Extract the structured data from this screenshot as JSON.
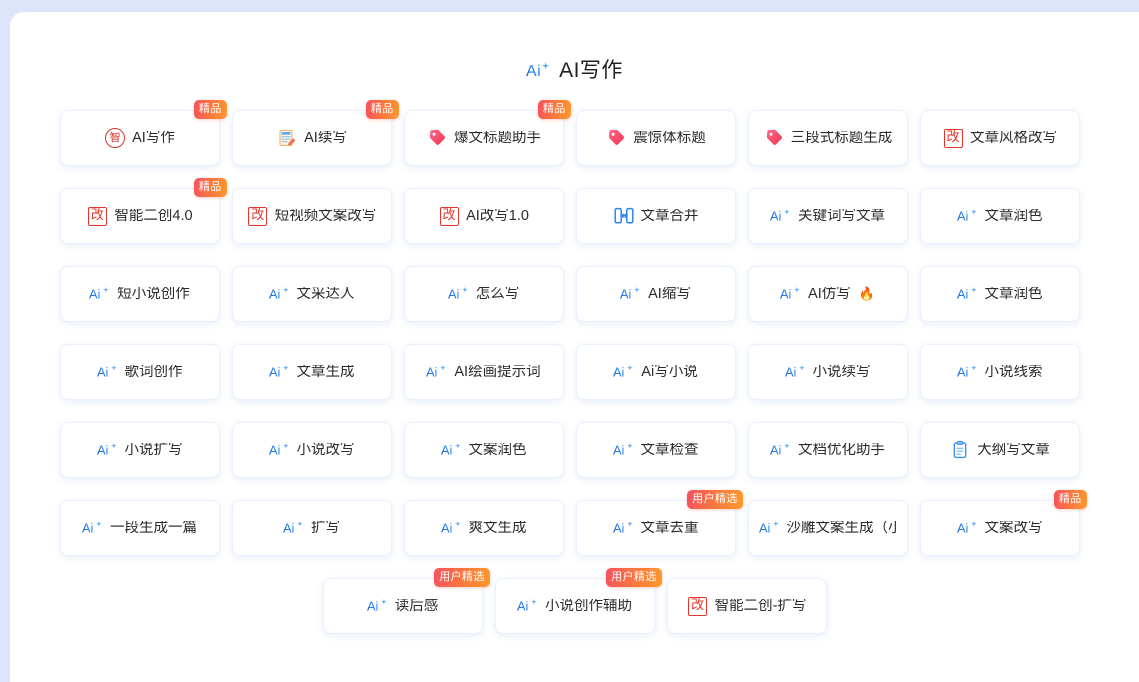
{
  "header": {
    "title": "AI写作",
    "icon": "ai-sparkle-icon"
  },
  "badges": {
    "premium": "精品",
    "user_pick": "用户精选"
  },
  "colors": {
    "page_background": "#dde5fb",
    "panel_background": "#ffffff",
    "card_border": "#e8f0fe",
    "ai_icon_blue": "#1677ff",
    "badge_gradient_start": "#f5515f",
    "badge_gradient_end": "#ff9a2e",
    "gai_icon_red": "#e8352c",
    "tag_icon_pink": "#f5486a",
    "text": "#2b2b2b"
  },
  "rows": [
    {
      "cards": [
        {
          "label": "AI写作",
          "icon": "seal-zhi-icon",
          "badge": "精品"
        },
        {
          "label": "AI续写",
          "icon": "document-pen-icon",
          "badge": "精品"
        },
        {
          "label": "爆文标题助手",
          "icon": "tag-icon",
          "badge": "精品"
        },
        {
          "label": "震惊体标题",
          "icon": "tag-icon",
          "badge": null
        },
        {
          "label": "三段式标题生成",
          "icon": "tag-icon",
          "badge": null
        },
        {
          "label": "文章风格改写",
          "icon": "gai-box-icon",
          "badge": null
        }
      ]
    },
    {
      "cards": [
        {
          "label": "智能二创4.0",
          "icon": "gai-box-icon",
          "badge": "精品"
        },
        {
          "label": "短视频文案改写",
          "icon": "gai-box-icon",
          "badge": null
        },
        {
          "label": "AI改写1.0",
          "icon": "gai-box-icon",
          "badge": null
        },
        {
          "label": "文章合并",
          "icon": "merge-icon",
          "badge": null
        },
        {
          "label": "关键词写文章",
          "icon": "ai-sparkle-icon",
          "badge": null
        },
        {
          "label": "文章润色",
          "icon": "ai-sparkle-icon",
          "badge": null
        }
      ]
    },
    {
      "cards": [
        {
          "label": "短小说创作",
          "icon": "ai-sparkle-icon",
          "badge": null
        },
        {
          "label": "文采达人",
          "icon": "ai-sparkle-icon",
          "badge": null
        },
        {
          "label": "怎么写",
          "icon": "ai-sparkle-icon",
          "badge": null
        },
        {
          "label": "AI缩写",
          "icon": "ai-sparkle-icon",
          "badge": null
        },
        {
          "label": "AI仿写",
          "icon": "ai-sparkle-icon",
          "badge": null,
          "suffix": "🔥"
        },
        {
          "label": "文章润色",
          "icon": "ai-sparkle-icon",
          "badge": null
        }
      ]
    },
    {
      "cards": [
        {
          "label": "歌词创作",
          "icon": "ai-sparkle-icon",
          "badge": null
        },
        {
          "label": "文章生成",
          "icon": "ai-sparkle-icon",
          "badge": null
        },
        {
          "label": "AI绘画提示词",
          "icon": "ai-sparkle-icon",
          "badge": null
        },
        {
          "label": "Ai写小说",
          "icon": "ai-sparkle-icon",
          "badge": null
        },
        {
          "label": "小说续写",
          "icon": "ai-sparkle-icon",
          "badge": null
        },
        {
          "label": "小说线索",
          "icon": "ai-sparkle-icon",
          "badge": null
        }
      ]
    },
    {
      "cards": [
        {
          "label": "小说扩写",
          "icon": "ai-sparkle-icon",
          "badge": null
        },
        {
          "label": "小说改写",
          "icon": "ai-sparkle-icon",
          "badge": null
        },
        {
          "label": "文案润色",
          "icon": "ai-sparkle-icon",
          "badge": null
        },
        {
          "label": "文章检查",
          "icon": "ai-sparkle-icon",
          "badge": null
        },
        {
          "label": "文档优化助手",
          "icon": "ai-sparkle-icon",
          "badge": null
        },
        {
          "label": "大纲写文章",
          "icon": "clipboard-icon",
          "badge": null
        }
      ]
    },
    {
      "cards": [
        {
          "label": "一段生成一篇",
          "icon": "ai-sparkle-icon",
          "badge": null
        },
        {
          "label": "扩写",
          "icon": "ai-sparkle-icon",
          "badge": null
        },
        {
          "label": "爽文生成",
          "icon": "ai-sparkle-icon",
          "badge": null
        },
        {
          "label": "文章去重",
          "icon": "ai-sparkle-icon",
          "badge": "用户精选"
        },
        {
          "label": "沙雕文案生成（小",
          "icon": "ai-sparkle-icon",
          "badge": null
        },
        {
          "label": "文案改写",
          "icon": "ai-sparkle-icon",
          "badge": "精品"
        }
      ]
    },
    {
      "offset": true,
      "cards": [
        {
          "label": "读后感",
          "icon": "ai-sparkle-icon",
          "badge": "用户精选"
        },
        {
          "label": "小说创作辅助",
          "icon": "ai-sparkle-icon",
          "badge": "用户精选"
        },
        {
          "label": "智能二创-扩写",
          "icon": "gai-box-icon",
          "badge": null
        }
      ]
    }
  ]
}
